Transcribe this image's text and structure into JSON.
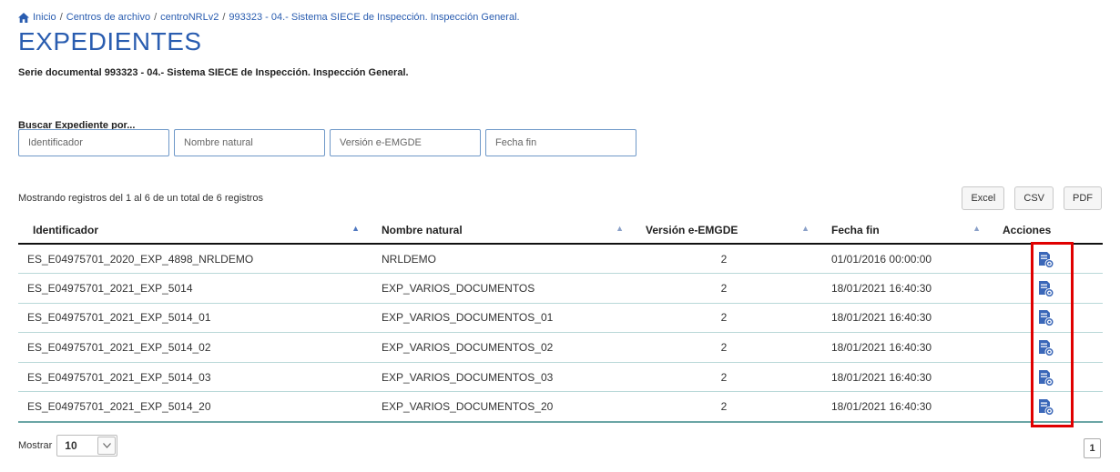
{
  "breadcrumb": {
    "items": [
      "Inicio",
      "Centros de archivo",
      "centroNRLv2",
      "993323 - 04.- Sistema SIECE de Inspección. Inspección General."
    ],
    "separator": "/"
  },
  "page_title": "EXPEDIENTES",
  "subtitle": "Serie documental 993323 - 04.- Sistema SIECE de Inspección. Inspección General.",
  "search": {
    "label": "Buscar Expediente por...",
    "fields": [
      {
        "placeholder": "Identificador",
        "value": ""
      },
      {
        "placeholder": "Nombre natural",
        "value": ""
      },
      {
        "placeholder": "Versión e-EMGDE",
        "value": ""
      },
      {
        "placeholder": "Fecha fin",
        "value": ""
      }
    ]
  },
  "info_text": "Mostrando registros del 1 al 6 de un total de 6 registros",
  "export": {
    "excel": "Excel",
    "csv": "CSV",
    "pdf": "PDF"
  },
  "table": {
    "headers": [
      "Identificador",
      "Nombre natural",
      "Versión e-EMGDE",
      "Fecha fin",
      "Acciones"
    ],
    "rows": [
      [
        "ES_E04975701_2020_EXP_4898_NRLDEMO",
        "NRLDEMO",
        "2",
        "01/01/2016 00:00:00"
      ],
      [
        "ES_E04975701_2021_EXP_5014",
        "EXP_VARIOS_DOCUMENTOS",
        "2",
        "18/01/2021 16:40:30"
      ],
      [
        "ES_E04975701_2021_EXP_5014_01",
        "EXP_VARIOS_DOCUMENTOS_01",
        "2",
        "18/01/2021 16:40:30"
      ],
      [
        "ES_E04975701_2021_EXP_5014_02",
        "EXP_VARIOS_DOCUMENTOS_02",
        "2",
        "18/01/2021 16:40:30"
      ],
      [
        "ES_E04975701_2021_EXP_5014_03",
        "EXP_VARIOS_DOCUMENTOS_03",
        "2",
        "18/01/2021 16:40:30"
      ],
      [
        "ES_E04975701_2021_EXP_5014_20",
        "EXP_VARIOS_DOCUMENTOS_20",
        "2",
        "18/01/2021 16:40:30"
      ]
    ],
    "action_icon": "view-document-icon"
  },
  "length": {
    "label": "Mostrar",
    "value": "10"
  },
  "pagination": {
    "current": "1"
  },
  "colors": {
    "accent": "#2a5db0",
    "highlight": "#e00000",
    "row_border": "#b9d8d8"
  }
}
